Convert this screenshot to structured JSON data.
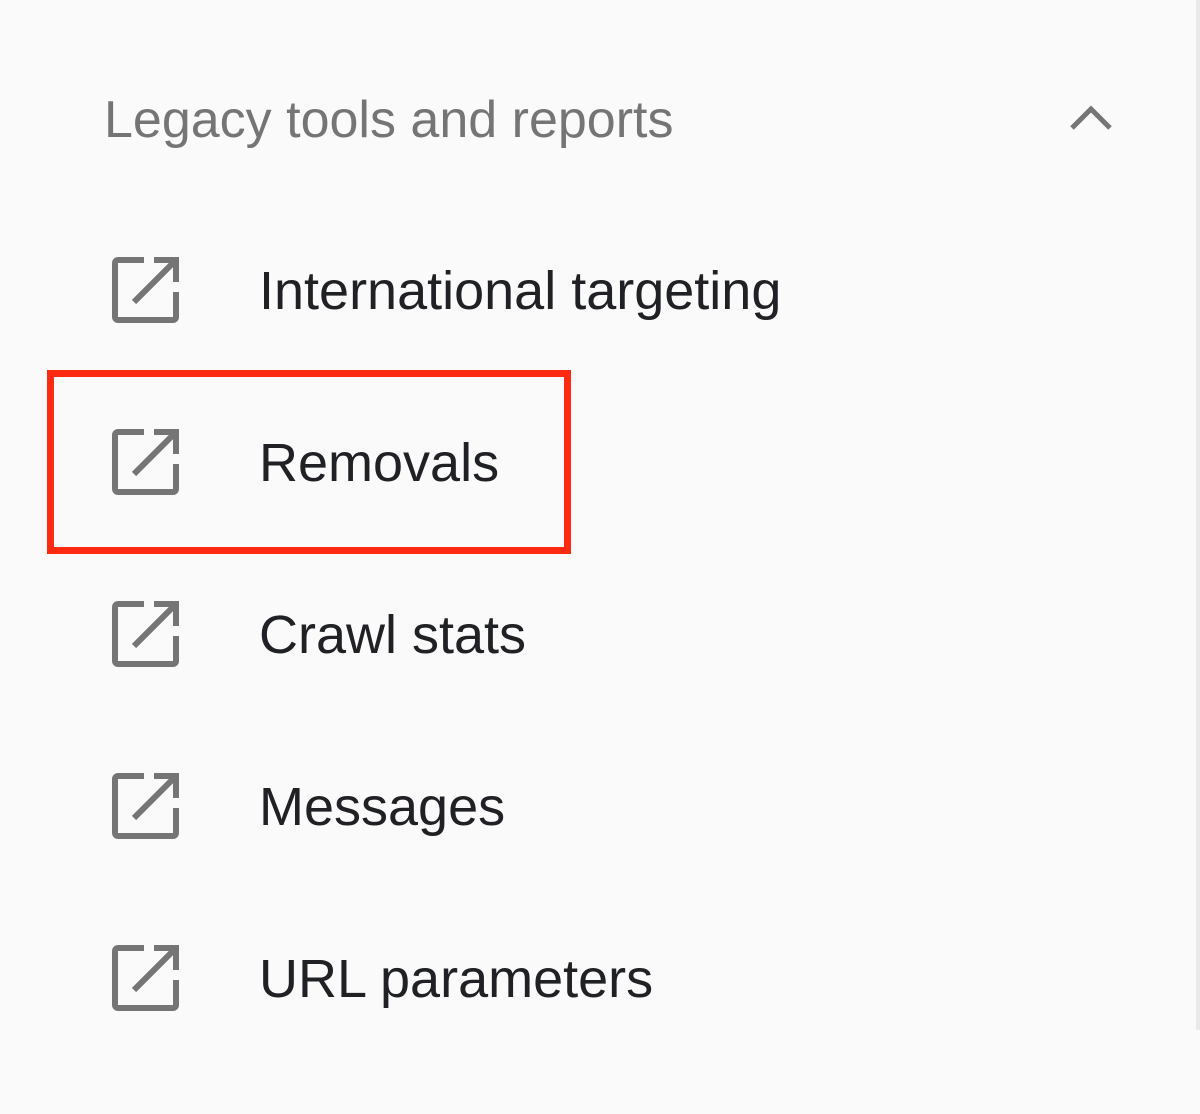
{
  "section": {
    "title": "Legacy tools and reports",
    "toggle_icon": "chevron-up-icon",
    "expanded": true
  },
  "items": [
    {
      "label": "International targeting",
      "icon": "open-in-new-icon"
    },
    {
      "label": "Removals",
      "icon": "open-in-new-icon",
      "highlighted": true
    },
    {
      "label": "Crawl stats",
      "icon": "open-in-new-icon"
    },
    {
      "label": "Messages",
      "icon": "open-in-new-icon"
    },
    {
      "label": "URL parameters",
      "icon": "open-in-new-icon"
    }
  ],
  "colors": {
    "background": "#fafafa",
    "header_text": "#757575",
    "item_text": "#202124",
    "icon": "#757575",
    "highlight": "#ff2a12"
  }
}
